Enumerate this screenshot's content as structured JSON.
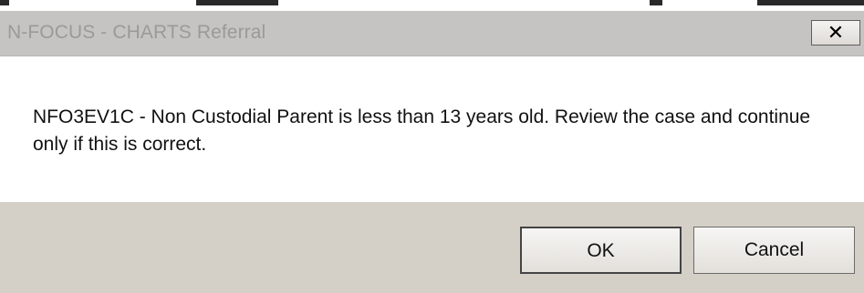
{
  "dialog": {
    "title": "N-FOCUS - CHARTS Referral",
    "close_icon": "close-icon",
    "close_glyph": "✕",
    "message": "NFO3EV1C - Non Custodial Parent is less than 13 years old. Review the case and continue only if this is correct.",
    "ok_label": "OK",
    "cancel_label": "Cancel"
  },
  "colors": {
    "titlebar": "#c5c4c3",
    "title_text": "#9a9a9a",
    "footer": "#d4d0c8",
    "content_bg": "#ffffff"
  }
}
